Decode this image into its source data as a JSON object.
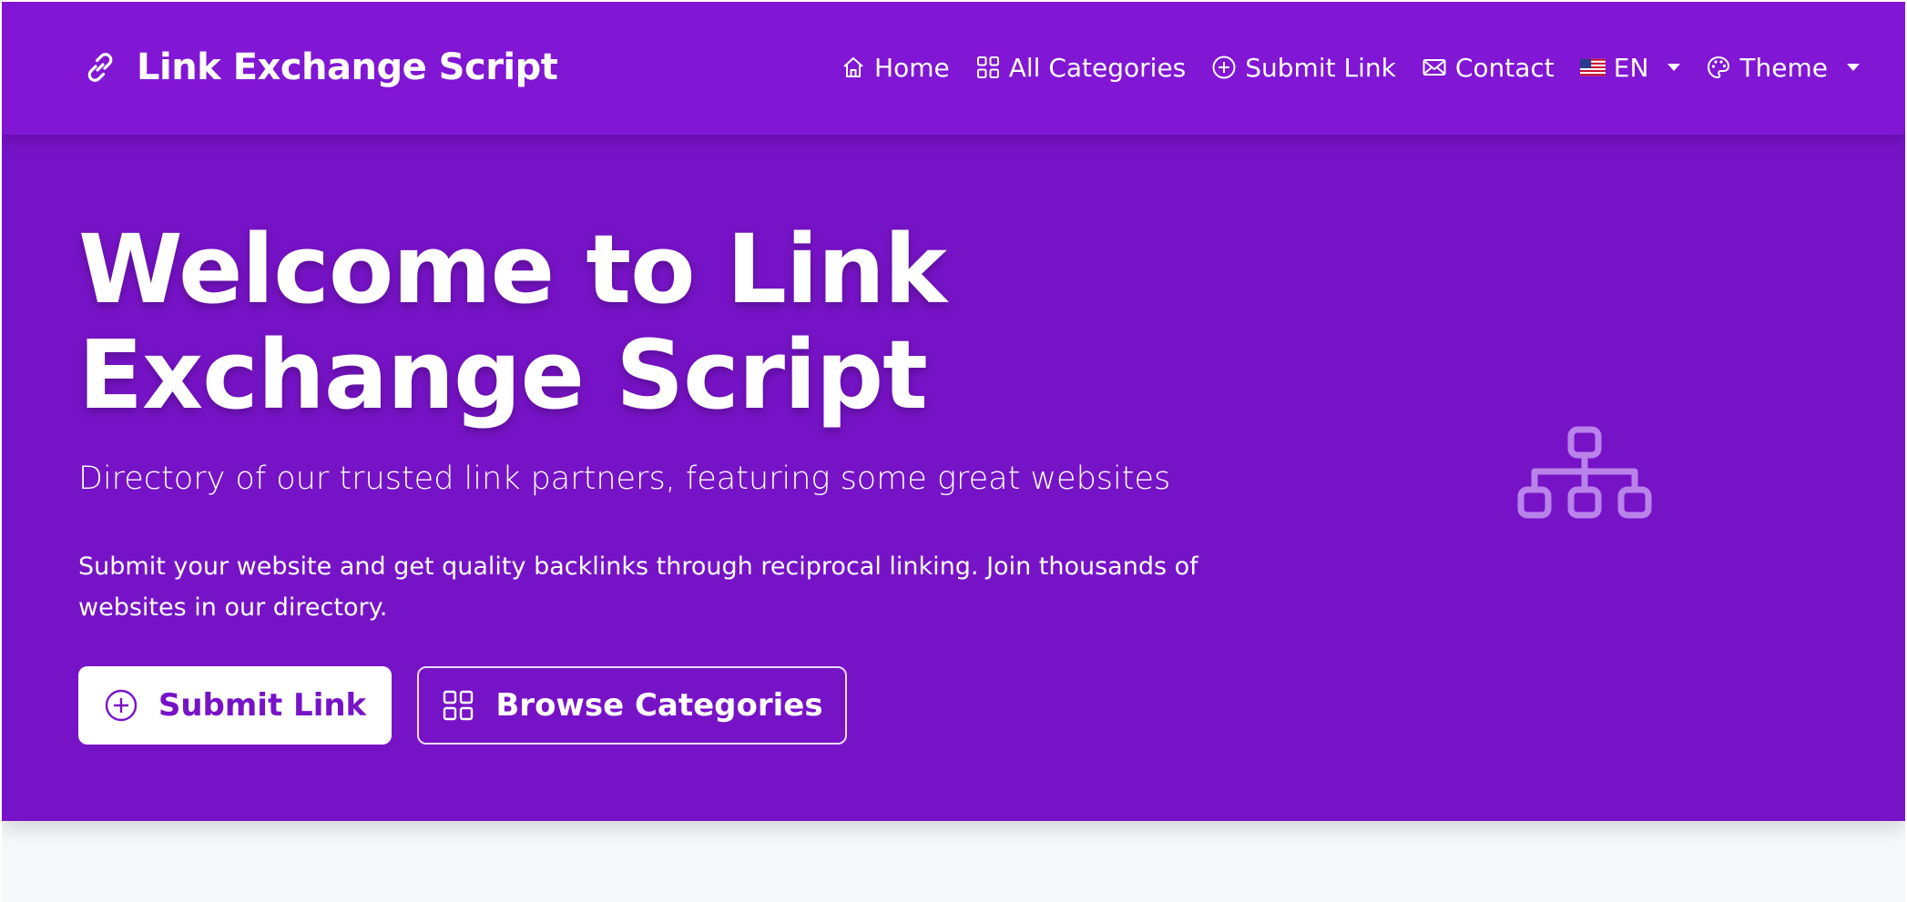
{
  "navbar": {
    "brand": "Link Exchange Script",
    "items": [
      {
        "label": "Home",
        "icon": "house-icon"
      },
      {
        "label": "All Categories",
        "icon": "grid-icon"
      },
      {
        "label": "Submit Link",
        "icon": "plus-circle-icon"
      },
      {
        "label": "Contact",
        "icon": "envelope-icon"
      }
    ],
    "language": {
      "label": "EN",
      "icon": "us-flag-icon"
    },
    "theme": {
      "label": "Theme",
      "icon": "palette-icon"
    }
  },
  "hero": {
    "title": "Welcome to Link Exchange Script",
    "subtitle": "Directory of our trusted link partners, featuring some great websites",
    "description": "Submit your website and get quality backlinks through reciprocal linking. Join thousands of websites in our directory.",
    "primary_button": "Submit Link",
    "secondary_button": "Browse Categories",
    "graphic_icon": "sitemap-icon"
  },
  "colors": {
    "navbar_bg": "#8116d4",
    "hero_bg": "#7713c7",
    "primary_text": "#7713c7",
    "page_bg": "#f7f8fa"
  }
}
